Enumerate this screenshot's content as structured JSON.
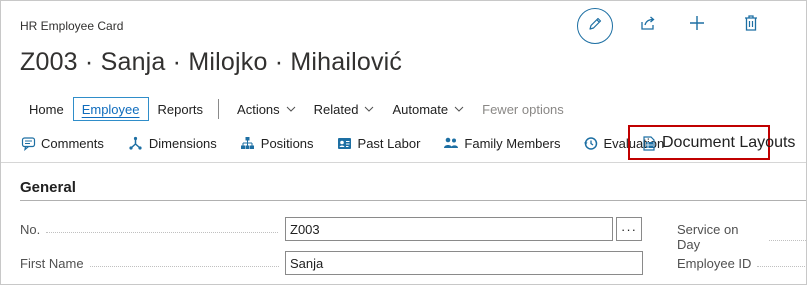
{
  "header": {
    "caption": "HR Employee Card",
    "title": "Z003 · Sanja · Milojko · Mihailović"
  },
  "top_actions": [
    {
      "name": "edit",
      "icon": "pencil-icon"
    },
    {
      "name": "share",
      "icon": "share-icon"
    },
    {
      "name": "new",
      "icon": "plus-icon"
    },
    {
      "name": "delete",
      "icon": "trash-icon"
    }
  ],
  "menu": {
    "home": "Home",
    "employee": "Employee",
    "reports": "Reports",
    "actions": "Actions",
    "related": "Related",
    "automate": "Automate",
    "fewer_options": "Fewer options"
  },
  "actions_bar": {
    "comments": "Comments",
    "dimensions": "Dimensions",
    "positions": "Positions",
    "past_labor": "Past Labor",
    "family_members": "Family Members",
    "evaluation": "Evaluation",
    "document_layouts": "Document Layouts"
  },
  "general": {
    "section_title": "General",
    "fields": {
      "no_label": "No.",
      "no_value": "Z003",
      "assist_label": "···",
      "first_name_label": "First Name",
      "first_name_value": "Sanja",
      "service_on_day_label": "Service on Day",
      "employee_id_label": "Employee ID"
    }
  },
  "colors": {
    "accent": "#0f6cbd",
    "highlight_border": "#c00000",
    "icon_teal": "#1d6fa3"
  }
}
